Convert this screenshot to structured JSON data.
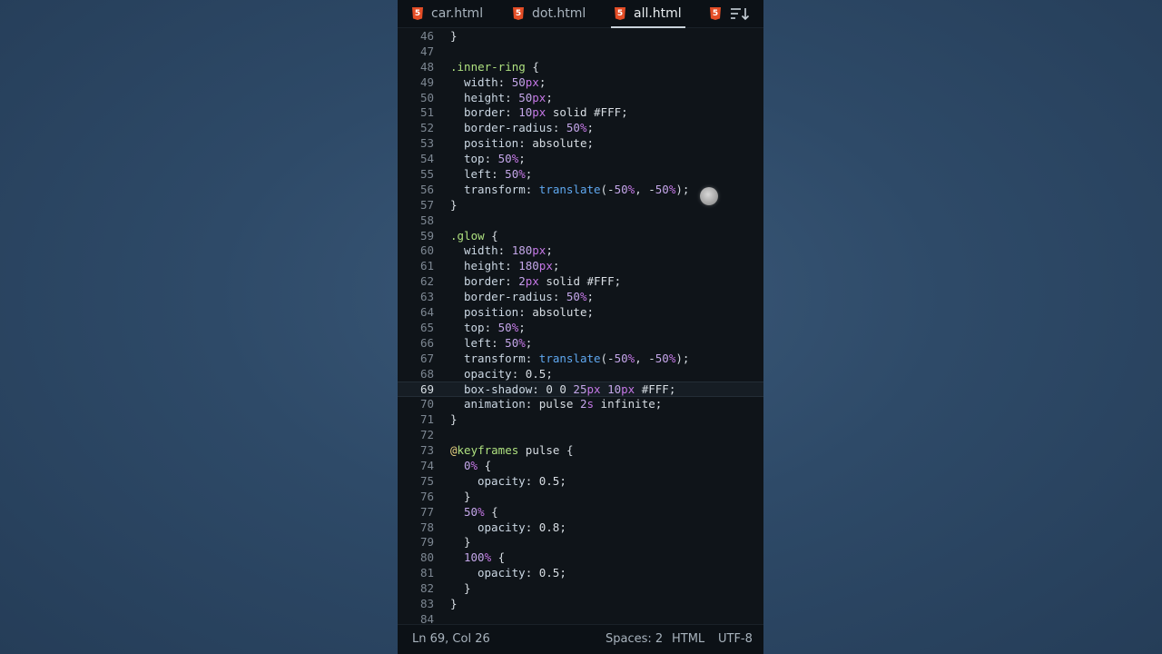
{
  "tabs": [
    {
      "label": "car.html",
      "icon": "html5-icon",
      "active": false
    },
    {
      "label": "dot.html",
      "icon": "html5-icon",
      "active": false
    },
    {
      "label": "all.html",
      "icon": "html5-icon",
      "active": true
    },
    {
      "label": "",
      "icon": "html5-icon",
      "active": false
    }
  ],
  "tab_overflow_icon": "sort-icon",
  "current_line": "69",
  "code_lines": [
    {
      "n": "46",
      "tokens": [
        {
          "t": "}",
          "c": "plain"
        }
      ]
    },
    {
      "n": "47",
      "tokens": []
    },
    {
      "n": "48",
      "tokens": [
        {
          "t": ".inner-ring",
          "c": "sel2"
        },
        {
          "t": " {",
          "c": "plain"
        }
      ]
    },
    {
      "n": "49",
      "indent": 1,
      "tokens": [
        {
          "t": "width",
          "c": "prop"
        },
        {
          "t": ": ",
          "c": "plain"
        },
        {
          "t": "50",
          "c": "num"
        },
        {
          "t": "px",
          "c": "unit"
        },
        {
          "t": ";",
          "c": "plain"
        }
      ]
    },
    {
      "n": "50",
      "indent": 1,
      "tokens": [
        {
          "t": "height",
          "c": "prop"
        },
        {
          "t": ": ",
          "c": "plain"
        },
        {
          "t": "50",
          "c": "num"
        },
        {
          "t": "px",
          "c": "unit"
        },
        {
          "t": ";",
          "c": "plain"
        }
      ]
    },
    {
      "n": "51",
      "indent": 1,
      "tokens": [
        {
          "t": "border",
          "c": "prop"
        },
        {
          "t": ": ",
          "c": "plain"
        },
        {
          "t": "10",
          "c": "num"
        },
        {
          "t": "px",
          "c": "unit"
        },
        {
          "t": " solid #FFF;",
          "c": "plain"
        }
      ]
    },
    {
      "n": "52",
      "indent": 1,
      "tokens": [
        {
          "t": "border-radius",
          "c": "prop"
        },
        {
          "t": ": ",
          "c": "plain"
        },
        {
          "t": "50",
          "c": "num"
        },
        {
          "t": "%",
          "c": "unit"
        },
        {
          "t": ";",
          "c": "plain"
        }
      ]
    },
    {
      "n": "53",
      "indent": 1,
      "tokens": [
        {
          "t": "position",
          "c": "prop"
        },
        {
          "t": ": absolute;",
          "c": "plain"
        }
      ]
    },
    {
      "n": "54",
      "indent": 1,
      "tokens": [
        {
          "t": "top",
          "c": "prop"
        },
        {
          "t": ": ",
          "c": "plain"
        },
        {
          "t": "50",
          "c": "num"
        },
        {
          "t": "%",
          "c": "unit"
        },
        {
          "t": ";",
          "c": "plain"
        }
      ]
    },
    {
      "n": "55",
      "indent": 1,
      "tokens": [
        {
          "t": "left",
          "c": "prop"
        },
        {
          "t": ": ",
          "c": "plain"
        },
        {
          "t": "50",
          "c": "num"
        },
        {
          "t": "%",
          "c": "unit"
        },
        {
          "t": ";",
          "c": "plain"
        }
      ]
    },
    {
      "n": "56",
      "indent": 1,
      "tokens": [
        {
          "t": "transform",
          "c": "prop"
        },
        {
          "t": ": ",
          "c": "plain"
        },
        {
          "t": "translate",
          "c": "fn"
        },
        {
          "t": "(-",
          "c": "plain"
        },
        {
          "t": "50",
          "c": "num"
        },
        {
          "t": "%",
          "c": "unit"
        },
        {
          "t": ", -",
          "c": "plain"
        },
        {
          "t": "50",
          "c": "num"
        },
        {
          "t": "%",
          "c": "unit"
        },
        {
          "t": ");",
          "c": "plain"
        }
      ]
    },
    {
      "n": "57",
      "tokens": [
        {
          "t": "}",
          "c": "plain"
        }
      ]
    },
    {
      "n": "58",
      "tokens": []
    },
    {
      "n": "59",
      "tokens": [
        {
          "t": ".glow",
          "c": "sel2"
        },
        {
          "t": " {",
          "c": "plain"
        }
      ]
    },
    {
      "n": "60",
      "indent": 1,
      "tokens": [
        {
          "t": "width",
          "c": "prop"
        },
        {
          "t": ": ",
          "c": "plain"
        },
        {
          "t": "180",
          "c": "num"
        },
        {
          "t": "px",
          "c": "unit"
        },
        {
          "t": ";",
          "c": "plain"
        }
      ]
    },
    {
      "n": "61",
      "indent": 1,
      "tokens": [
        {
          "t": "height",
          "c": "prop"
        },
        {
          "t": ": ",
          "c": "plain"
        },
        {
          "t": "180",
          "c": "num"
        },
        {
          "t": "px",
          "c": "unit"
        },
        {
          "t": ";",
          "c": "plain"
        }
      ]
    },
    {
      "n": "62",
      "indent": 1,
      "tokens": [
        {
          "t": "border",
          "c": "prop"
        },
        {
          "t": ": ",
          "c": "plain"
        },
        {
          "t": "2",
          "c": "num"
        },
        {
          "t": "px",
          "c": "unit"
        },
        {
          "t": " solid #FFF;",
          "c": "plain"
        }
      ]
    },
    {
      "n": "63",
      "indent": 1,
      "tokens": [
        {
          "t": "border-radius",
          "c": "prop"
        },
        {
          "t": ": ",
          "c": "plain"
        },
        {
          "t": "50",
          "c": "num"
        },
        {
          "t": "%",
          "c": "unit"
        },
        {
          "t": ";",
          "c": "plain"
        }
      ]
    },
    {
      "n": "64",
      "indent": 1,
      "tokens": [
        {
          "t": "position",
          "c": "prop"
        },
        {
          "t": ": absolute;",
          "c": "plain"
        }
      ]
    },
    {
      "n": "65",
      "indent": 1,
      "tokens": [
        {
          "t": "top",
          "c": "prop"
        },
        {
          "t": ": ",
          "c": "plain"
        },
        {
          "t": "50",
          "c": "num"
        },
        {
          "t": "%",
          "c": "unit"
        },
        {
          "t": ";",
          "c": "plain"
        }
      ]
    },
    {
      "n": "66",
      "indent": 1,
      "tokens": [
        {
          "t": "left",
          "c": "prop"
        },
        {
          "t": ": ",
          "c": "plain"
        },
        {
          "t": "50",
          "c": "num"
        },
        {
          "t": "%",
          "c": "unit"
        },
        {
          "t": ";",
          "c": "plain"
        }
      ]
    },
    {
      "n": "67",
      "indent": 1,
      "tokens": [
        {
          "t": "transform",
          "c": "prop"
        },
        {
          "t": ": ",
          "c": "plain"
        },
        {
          "t": "translate",
          "c": "fn"
        },
        {
          "t": "(-",
          "c": "plain"
        },
        {
          "t": "50",
          "c": "num"
        },
        {
          "t": "%",
          "c": "unit"
        },
        {
          "t": ", -",
          "c": "plain"
        },
        {
          "t": "50",
          "c": "num"
        },
        {
          "t": "%",
          "c": "unit"
        },
        {
          "t": ");",
          "c": "plain"
        }
      ]
    },
    {
      "n": "68",
      "indent": 1,
      "tokens": [
        {
          "t": "opacity",
          "c": "prop"
        },
        {
          "t": ": 0.5;",
          "c": "plain"
        }
      ]
    },
    {
      "n": "69",
      "indent": 1,
      "tokens": [
        {
          "t": "box-shadow",
          "c": "prop"
        },
        {
          "t": ": 0 0 ",
          "c": "plain"
        },
        {
          "t": "25",
          "c": "num"
        },
        {
          "t": "px",
          "c": "unit"
        },
        {
          "t": " ",
          "c": "plain"
        },
        {
          "t": "10",
          "c": "num"
        },
        {
          "t": "px",
          "c": "unit"
        },
        {
          "t": " #FFF;",
          "c": "plain"
        }
      ]
    },
    {
      "n": "70",
      "indent": 1,
      "tokens": [
        {
          "t": "animation",
          "c": "prop"
        },
        {
          "t": ": pulse ",
          "c": "plain"
        },
        {
          "t": "2",
          "c": "num"
        },
        {
          "t": "s",
          "c": "unit"
        },
        {
          "t": " infinite;",
          "c": "plain"
        }
      ]
    },
    {
      "n": "71",
      "tokens": [
        {
          "t": "}",
          "c": "plain"
        }
      ]
    },
    {
      "n": "72",
      "tokens": []
    },
    {
      "n": "73",
      "tokens": [
        {
          "t": "@",
          "c": "at"
        },
        {
          "t": "keyframes",
          "c": "sel2"
        },
        {
          "t": " pulse {",
          "c": "plain"
        }
      ]
    },
    {
      "n": "74",
      "indent": 1,
      "tokens": [
        {
          "t": "0",
          "c": "num"
        },
        {
          "t": "%",
          "c": "unit"
        },
        {
          "t": " {",
          "c": "plain"
        }
      ]
    },
    {
      "n": "75",
      "indent": 2,
      "tokens": [
        {
          "t": "opacity",
          "c": "prop"
        },
        {
          "t": ": 0.5;",
          "c": "plain"
        }
      ]
    },
    {
      "n": "76",
      "indent": 1,
      "tokens": [
        {
          "t": "}",
          "c": "plain"
        }
      ]
    },
    {
      "n": "77",
      "indent": 1,
      "tokens": [
        {
          "t": "50",
          "c": "num"
        },
        {
          "t": "%",
          "c": "unit"
        },
        {
          "t": " {",
          "c": "plain"
        }
      ]
    },
    {
      "n": "78",
      "indent": 2,
      "tokens": [
        {
          "t": "opacity",
          "c": "prop"
        },
        {
          "t": ": 0.8;",
          "c": "plain"
        }
      ]
    },
    {
      "n": "79",
      "indent": 1,
      "tokens": [
        {
          "t": "}",
          "c": "plain"
        }
      ]
    },
    {
      "n": "80",
      "indent": 1,
      "tokens": [
        {
          "t": "100",
          "c": "num"
        },
        {
          "t": "%",
          "c": "unit"
        },
        {
          "t": " {",
          "c": "plain"
        }
      ]
    },
    {
      "n": "81",
      "indent": 2,
      "tokens": [
        {
          "t": "opacity",
          "c": "prop"
        },
        {
          "t": ": 0.5;",
          "c": "plain"
        }
      ]
    },
    {
      "n": "82",
      "indent": 1,
      "tokens": [
        {
          "t": "}",
          "c": "plain"
        }
      ]
    },
    {
      "n": "83",
      "tokens": [
        {
          "t": "}",
          "c": "plain"
        }
      ]
    },
    {
      "n": "84",
      "tokens": []
    }
  ],
  "status": {
    "position": "Ln 69, Col 26",
    "spaces": "Spaces: 2",
    "language": "HTML",
    "encoding": "UTF-8"
  },
  "colors": {
    "editor_bg": "#0f1419",
    "html5_icon": "#e44d26",
    "selector": "#aee07f",
    "number": "#c3a6e8",
    "unit": "#c577e6",
    "function": "#5fa8f0"
  }
}
